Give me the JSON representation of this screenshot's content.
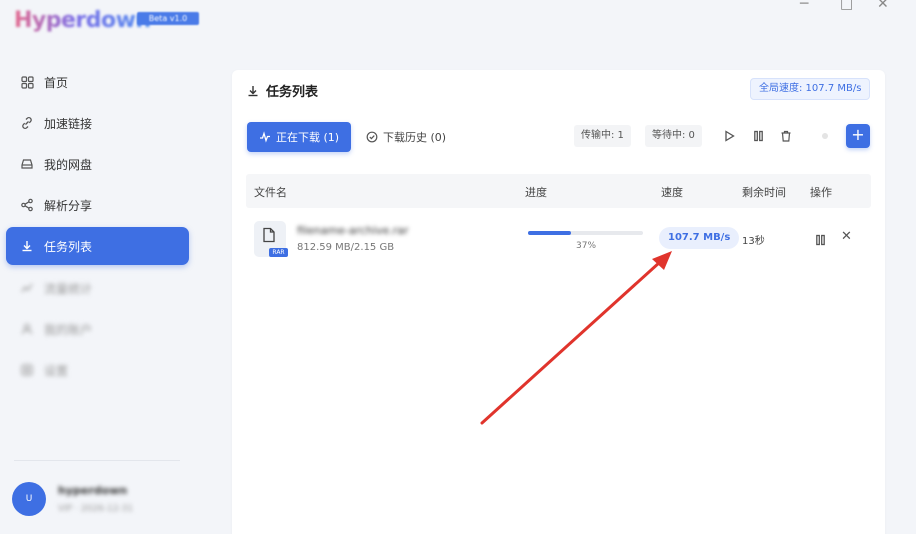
{
  "app": {
    "title": "Hyperdown",
    "version_badge": "Beta v1.0",
    "window_controls": [
      "─",
      "□",
      "✕"
    ]
  },
  "sidebar": {
    "items": [
      {
        "label": "首页",
        "icon": "grid-icon"
      },
      {
        "label": "加速链接",
        "icon": "link-icon"
      },
      {
        "label": "我的网盘",
        "icon": "drive-icon"
      },
      {
        "label": "解析分享",
        "icon": "share-icon"
      },
      {
        "label": "任务列表",
        "icon": "download-icon"
      },
      {
        "label": "流量统计",
        "icon": "chart-icon"
      },
      {
        "label": "我的账户",
        "icon": "user-icon"
      },
      {
        "label": "设置",
        "icon": "settings-icon"
      }
    ],
    "active_index": 4,
    "user": {
      "avatar_text": "U",
      "name": "hyperdown",
      "subtitle": "VIP · 2026-12-31"
    }
  },
  "panel": {
    "title": "任务列表",
    "global_speed": "全局速度: 107.7 MB/s",
    "tabs": {
      "downloading": "正在下载 (1)",
      "history": "下载历史 (0)"
    },
    "chips": {
      "transfer": "传输中: 1",
      "waiting": "等待中: 0"
    },
    "add_label": "+"
  },
  "table": {
    "headers": {
      "name": "文件名",
      "progress": "进度",
      "speed": "速度",
      "remaining": "剩余时间",
      "actions": "操作"
    },
    "rows": [
      {
        "file_name": "filename-archive.rar",
        "file_type": "RAR",
        "size": "812.59 MB/2.15 GB",
        "progress": 0.37,
        "progress_text": "37%",
        "speed": "107.7 MB/s",
        "remaining": "13秒"
      }
    ]
  },
  "colors": {
    "accent": "#3e6fe3",
    "annotation_arrow": "#e0342c"
  }
}
